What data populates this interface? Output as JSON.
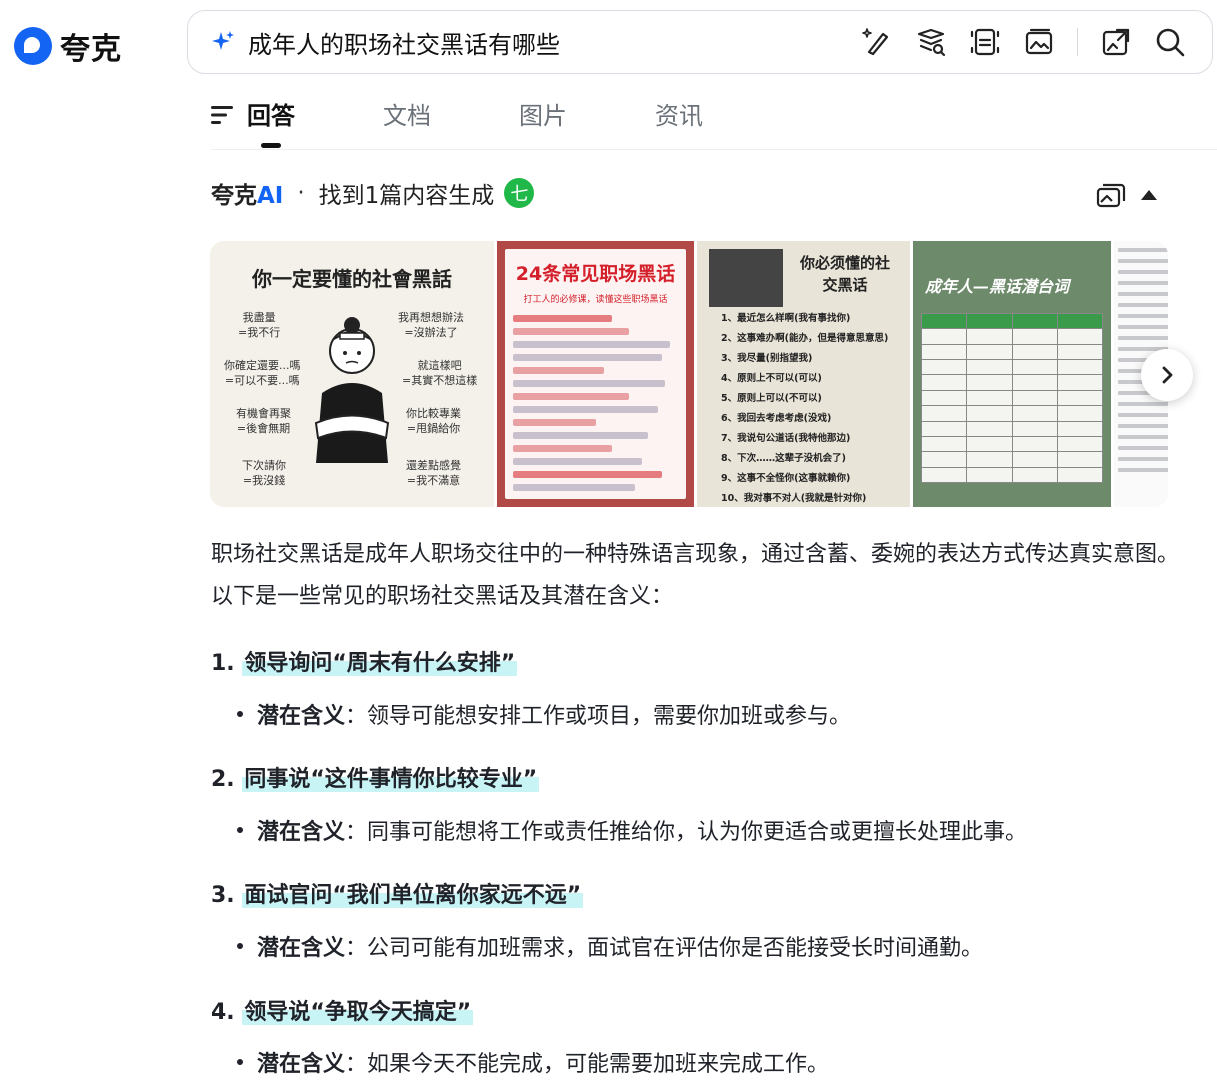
{
  "header": {
    "logo_text": "夸克",
    "query": "成年人的职场社交黑话有哪些",
    "icons": [
      "sparkle-icon",
      "pen-icon",
      "translate-icon",
      "scan-icon",
      "image-search-icon",
      "screenshot-icon",
      "search-icon"
    ]
  },
  "tabs": [
    {
      "label": "回答",
      "active": true
    },
    {
      "label": "文档",
      "active": false
    },
    {
      "label": "图片",
      "active": false
    },
    {
      "label": "资讯",
      "active": false
    }
  ],
  "ai": {
    "brand": "夸克",
    "brand_ai": "AI",
    "separator": "·",
    "status": "找到1篇内容生成",
    "badge": "七"
  },
  "images": {
    "img1": {
      "title": "你一定要懂的社會黑話",
      "pairs": [
        "我盡量\n=我不行",
        "我再想想辦法\n=沒辦法了",
        "你確定還要...嗎\n=可以不要...嗎",
        "就這樣吧\n=其實不想這樣",
        "有機會再聚\n=後會無期",
        "你比較專業\n=甩鍋給你",
        "下次請你\n=我沒錢",
        "還差點感覺\n=我不滿意"
      ]
    },
    "img2": {
      "title": "24条常见职场黑话",
      "subtitle": "打工人的必修课，读懂这些职场黑话"
    },
    "img3": {
      "title": "你必须懂的社交黑话",
      "items": [
        "1、最近怎么样啊(我有事找你)",
        "2、这事难办啊(能办，但是得意思意思)",
        "3、我尽量(别指望我)",
        "4、原则上不可以(可以)",
        "5、原则上可以(不可以)",
        "6、我回去考虑考虑(没戏)",
        "7、我说句公道话(我特他那边)",
        "8、下次……这辈子没机会了)",
        "9、这事不全怪你(这事就赖你)",
        "10、我对事不对人(我就是针对你)"
      ]
    },
    "img4": {
      "title": "成年人—黑话潜台词"
    }
  },
  "answer": {
    "intro": "职场社交黑话是成年人职场交往中的一种特殊语言现象，通过含蓄、委婉的表达方式传达真实意图。以下是一些常见的职场社交黑话及其潜在含义：",
    "label": "潜在含义",
    "items": [
      {
        "num": "1.",
        "title": "领导询问“周末有什么安排”",
        "meaning": "：领导可能想安排工作或项目，需要你加班或参与。"
      },
      {
        "num": "2.",
        "title": "同事说“这件事情你比较专业”",
        "meaning": "：同事可能想将工作或责任推给你，认为你更适合或更擅长处理此事。"
      },
      {
        "num": "3.",
        "title": "面试官问“我们单位离你家远不远”",
        "meaning": "：公司可能有加班需求，面试官在评估你是否能接受长时间通勤。"
      },
      {
        "num": "4.",
        "title": "领导说“争取今天搞定”",
        "meaning": "：如果今天不能完成，可能需要加班来完成工作。"
      }
    ]
  }
}
